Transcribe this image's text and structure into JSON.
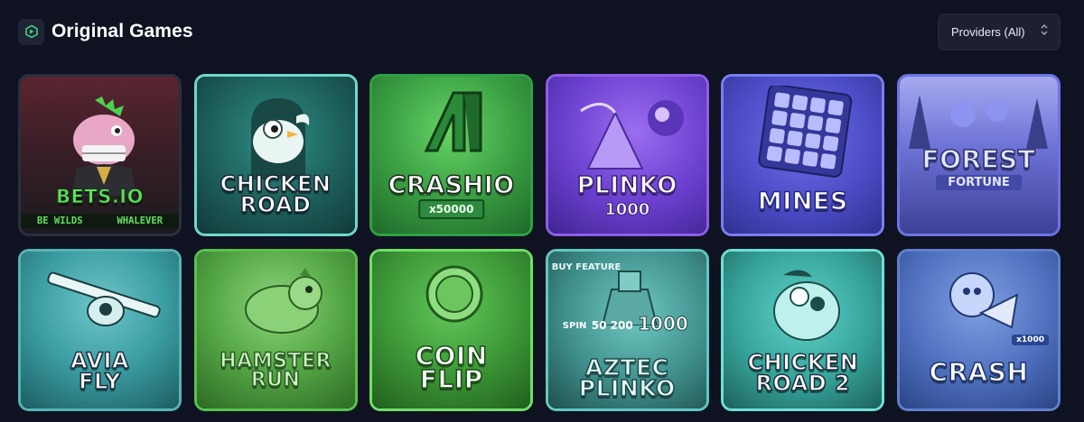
{
  "header": {
    "title": "Original Games",
    "title_icon": "games-cube-icon",
    "providers_label": "Providers (All)",
    "providers_icon": "chevron-updown-icon"
  },
  "colors": {
    "background": "#0f1220",
    "panel": "#1c2031",
    "text": "#ffffff"
  },
  "games": [
    {
      "id": "betsio",
      "logo": "BETS.IO",
      "ticker": "BE WILDS      WHALEVER",
      "theme": "red-pink"
    },
    {
      "id": "chicken-road",
      "logo_line1": "CHICKEN",
      "logo_line2": "ROAD",
      "theme": "teal"
    },
    {
      "id": "crashio",
      "logo": "CRASHIO",
      "badge": "x50000",
      "theme": "green"
    },
    {
      "id": "plinko-1000",
      "logo": "PLINKO",
      "sub": "1000",
      "theme": "purple"
    },
    {
      "id": "mines",
      "logo": "MINES",
      "theme": "indigo"
    },
    {
      "id": "forest-fortune",
      "logo": "FOREST",
      "sub": "FORTUNE",
      "theme": "blue-violet"
    },
    {
      "id": "avia-fly",
      "logo_line1": "AVIA",
      "logo_line2": "FLY",
      "theme": "cyan"
    },
    {
      "id": "hamster-run",
      "logo_line1": "HAMSTER",
      "logo_line2": "RUN",
      "theme": "lime"
    },
    {
      "id": "coin-flip",
      "logo_line1": "COIN",
      "logo_line2": "FLIP",
      "theme": "green2"
    },
    {
      "id": "aztec-plinko",
      "tag": "BUY FEATURE",
      "spin": "SPIN",
      "multipliers": "50 200",
      "big": "1000",
      "logo_line1": "AZTEC",
      "logo_line2": "PLINKO",
      "theme": "teal2"
    },
    {
      "id": "chicken-road-2",
      "logo_line1": "CHICKEN",
      "logo_line2": "ROAD 2",
      "theme": "aqua"
    },
    {
      "id": "crash",
      "logo": "CRASH",
      "badge": "x1000",
      "theme": "steel-blue"
    }
  ]
}
